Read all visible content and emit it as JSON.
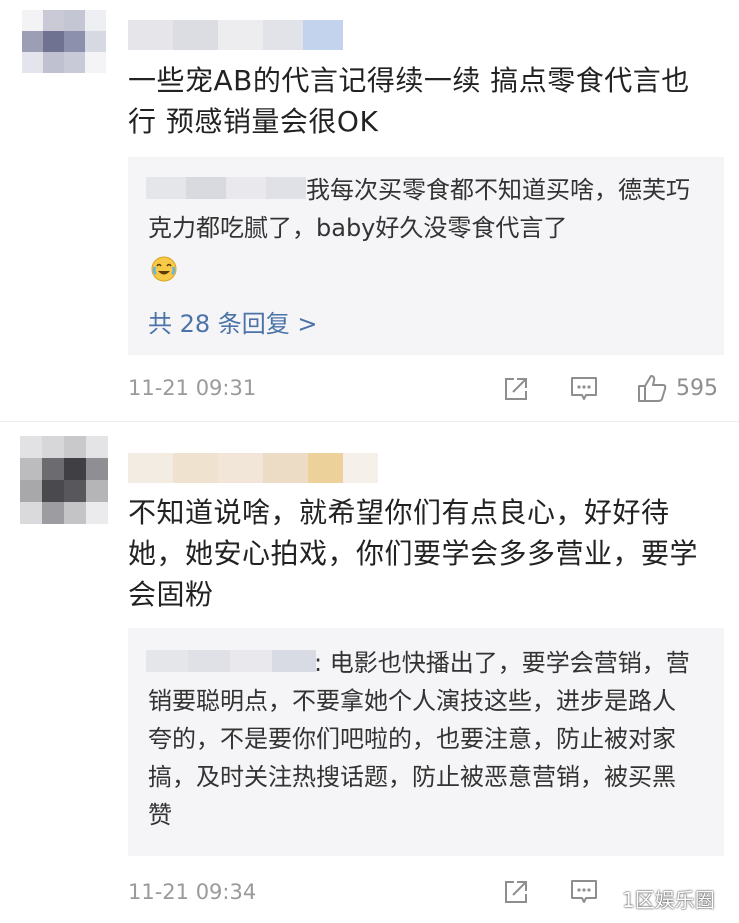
{
  "comments": [
    {
      "text": "一些宠AB的代言记得续一续 搞点零食代言也行 预感销量会很OK",
      "reply": {
        "text": "我每次买零食都不知道买啥，德芙巧克力都吃腻了，baby好久没零食代言了",
        "emoji": "crying-laugh-emoji",
        "more_label": "共 28 条回复 >"
      },
      "time": "11-21 09:31",
      "likes": "595"
    },
    {
      "text": "不知道说啥，就希望你们有点良心，好好待她，她安心拍戏，你们要学会多多营业，要学会固粉",
      "reply": {
        "text": ": 电影也快播出了，要学会营销，营销要聪明点，不要拿她个人演技这些，进步是路人夸的，不是要你们吧啦的，也要注意，防止被对家搞，及时关注热搜话题，防止被恶意营销，被买黑赞"
      },
      "time": "11-21 09:34"
    }
  ],
  "watermark": "1区娱乐圈",
  "icons": {
    "share": "share-icon",
    "comment": "comment-icon",
    "like": "thumbs-up-icon"
  },
  "colors": {
    "link": "#4b73a8",
    "meta": "#9a9a9a",
    "reply_bg": "#f5f5f7"
  }
}
